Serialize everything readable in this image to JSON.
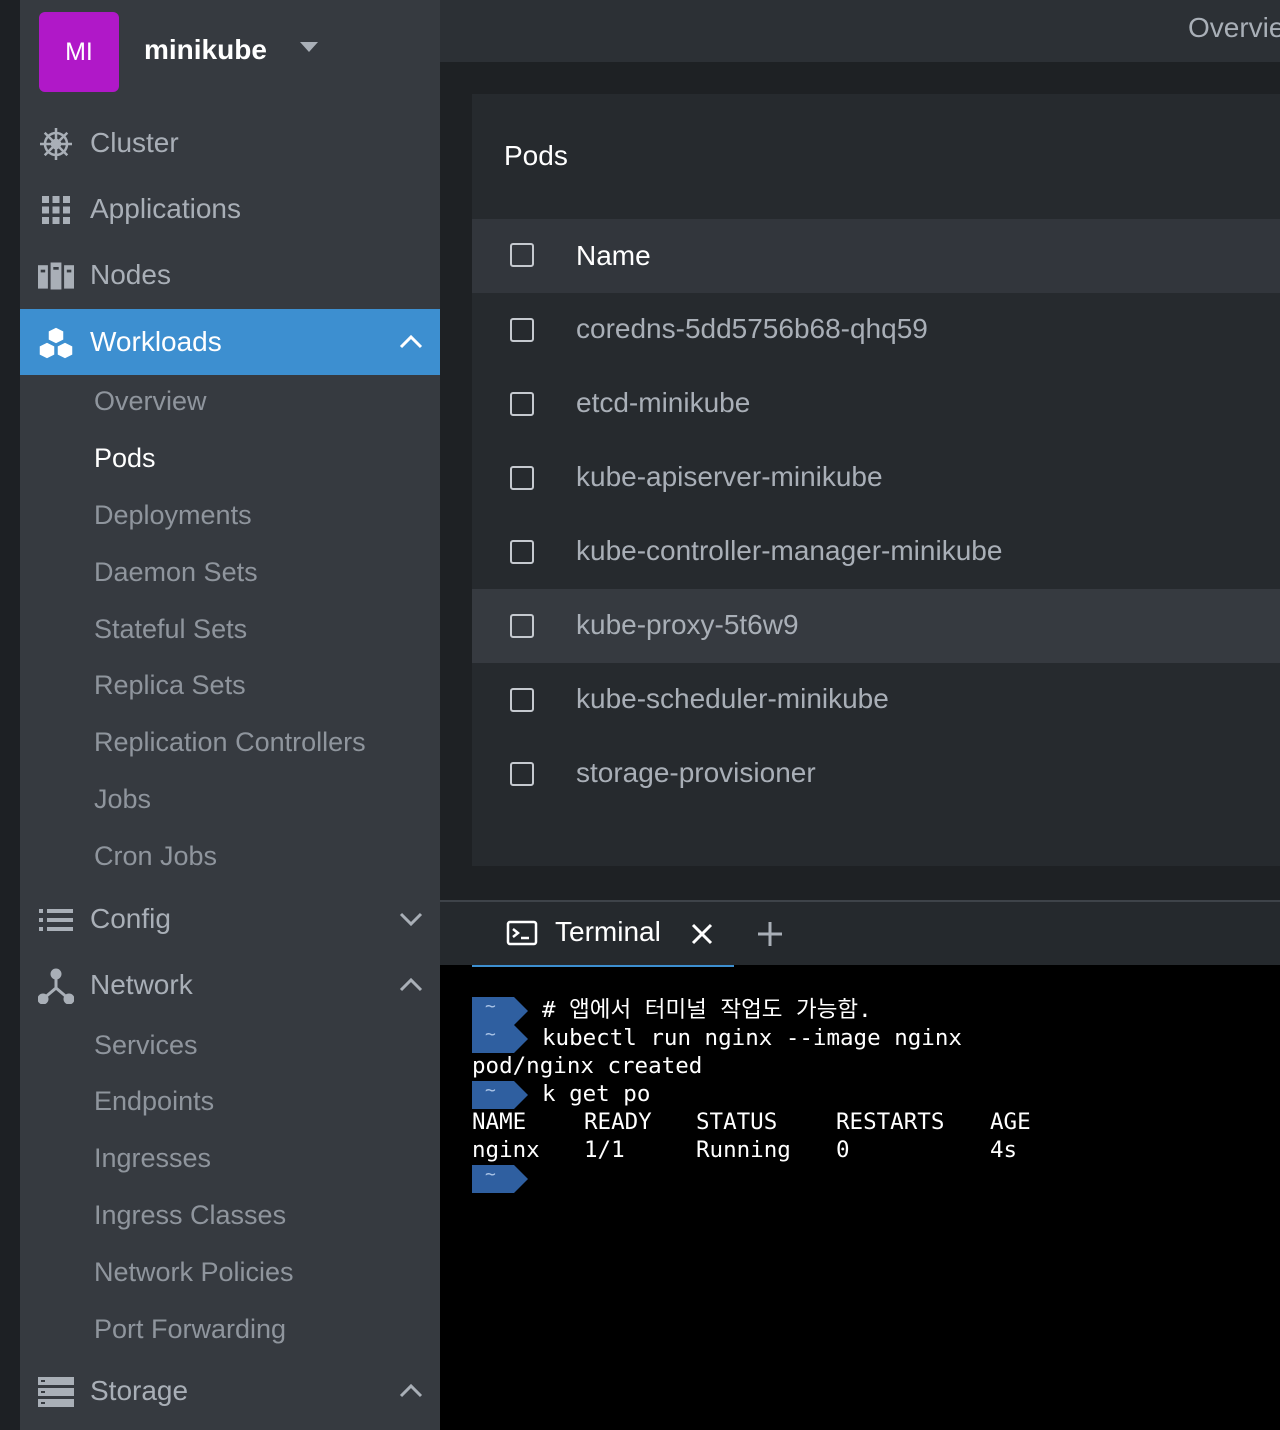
{
  "cluster": {
    "avatar": "MI",
    "name": "minikube"
  },
  "nav": {
    "cluster": "Cluster",
    "applications": "Applications",
    "nodes": "Nodes",
    "workloads": "Workloads",
    "config": "Config",
    "network": "Network",
    "storage": "Storage"
  },
  "workloads_sub": [
    "Overview",
    "Pods",
    "Deployments",
    "Daemon Sets",
    "Stateful Sets",
    "Replica Sets",
    "Replication Controllers",
    "Jobs",
    "Cron Jobs"
  ],
  "network_sub": [
    "Services",
    "Endpoints",
    "Ingresses",
    "Ingress Classes",
    "Network Policies",
    "Port Forwarding"
  ],
  "topbar": {
    "title": "Overvie"
  },
  "pods": {
    "title": "Pods",
    "column_name": "Name",
    "rows": [
      "coredns-5dd5756b68-qhq59",
      "etcd-minikube",
      "kube-apiserver-minikube",
      "kube-controller-manager-minikube",
      "kube-proxy-5t6w9",
      "kube-scheduler-minikube",
      "storage-provisioner"
    ]
  },
  "dock": {
    "terminal_tab": "Terminal"
  },
  "terminal": {
    "prompt": "~",
    "comment": "# 앱에서 터미널 작업도 가능함.",
    "cmd1": "kubectl run nginx --image nginx",
    "out1": "pod/nginx created",
    "cmd2": "k get po",
    "headers": [
      "NAME",
      "READY",
      "STATUS",
      "RESTARTS",
      "AGE"
    ],
    "row": [
      "nginx",
      "1/1",
      "Running",
      "0",
      "4s"
    ]
  },
  "colors": {
    "accent": "#3d8fd0",
    "avatar": "#b018c8",
    "prompt": "#2f5fa0"
  },
  "icons": {
    "cluster": "helm-wheel-icon",
    "applications": "grid-icon",
    "nodes": "servers-icon",
    "workloads": "cubes-icon",
    "config": "list-icon",
    "network": "network-icon",
    "storage": "storage-icon"
  }
}
